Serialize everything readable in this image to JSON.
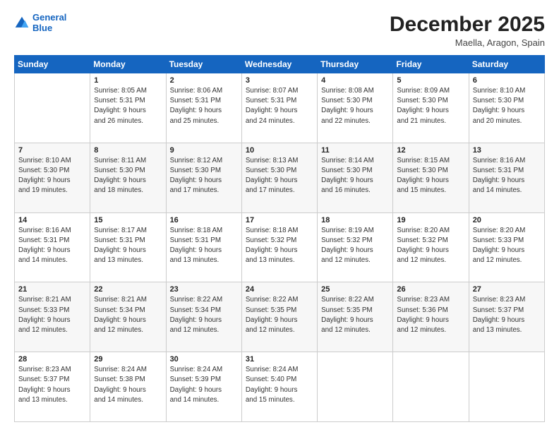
{
  "logo": {
    "line1": "General",
    "line2": "Blue"
  },
  "title": "December 2025",
  "location": "Maella, Aragon, Spain",
  "weekdays": [
    "Sunday",
    "Monday",
    "Tuesday",
    "Wednesday",
    "Thursday",
    "Friday",
    "Saturday"
  ],
  "weeks": [
    [
      {
        "day": "",
        "info": ""
      },
      {
        "day": "1",
        "info": "Sunrise: 8:05 AM\nSunset: 5:31 PM\nDaylight: 9 hours\nand 26 minutes."
      },
      {
        "day": "2",
        "info": "Sunrise: 8:06 AM\nSunset: 5:31 PM\nDaylight: 9 hours\nand 25 minutes."
      },
      {
        "day": "3",
        "info": "Sunrise: 8:07 AM\nSunset: 5:31 PM\nDaylight: 9 hours\nand 24 minutes."
      },
      {
        "day": "4",
        "info": "Sunrise: 8:08 AM\nSunset: 5:30 PM\nDaylight: 9 hours\nand 22 minutes."
      },
      {
        "day": "5",
        "info": "Sunrise: 8:09 AM\nSunset: 5:30 PM\nDaylight: 9 hours\nand 21 minutes."
      },
      {
        "day": "6",
        "info": "Sunrise: 8:10 AM\nSunset: 5:30 PM\nDaylight: 9 hours\nand 20 minutes."
      }
    ],
    [
      {
        "day": "7",
        "info": "Sunrise: 8:10 AM\nSunset: 5:30 PM\nDaylight: 9 hours\nand 19 minutes."
      },
      {
        "day": "8",
        "info": "Sunrise: 8:11 AM\nSunset: 5:30 PM\nDaylight: 9 hours\nand 18 minutes."
      },
      {
        "day": "9",
        "info": "Sunrise: 8:12 AM\nSunset: 5:30 PM\nDaylight: 9 hours\nand 17 minutes."
      },
      {
        "day": "10",
        "info": "Sunrise: 8:13 AM\nSunset: 5:30 PM\nDaylight: 9 hours\nand 17 minutes."
      },
      {
        "day": "11",
        "info": "Sunrise: 8:14 AM\nSunset: 5:30 PM\nDaylight: 9 hours\nand 16 minutes."
      },
      {
        "day": "12",
        "info": "Sunrise: 8:15 AM\nSunset: 5:30 PM\nDaylight: 9 hours\nand 15 minutes."
      },
      {
        "day": "13",
        "info": "Sunrise: 8:16 AM\nSunset: 5:31 PM\nDaylight: 9 hours\nand 14 minutes."
      }
    ],
    [
      {
        "day": "14",
        "info": "Sunrise: 8:16 AM\nSunset: 5:31 PM\nDaylight: 9 hours\nand 14 minutes."
      },
      {
        "day": "15",
        "info": "Sunrise: 8:17 AM\nSunset: 5:31 PM\nDaylight: 9 hours\nand 13 minutes."
      },
      {
        "day": "16",
        "info": "Sunrise: 8:18 AM\nSunset: 5:31 PM\nDaylight: 9 hours\nand 13 minutes."
      },
      {
        "day": "17",
        "info": "Sunrise: 8:18 AM\nSunset: 5:32 PM\nDaylight: 9 hours\nand 13 minutes."
      },
      {
        "day": "18",
        "info": "Sunrise: 8:19 AM\nSunset: 5:32 PM\nDaylight: 9 hours\nand 12 minutes."
      },
      {
        "day": "19",
        "info": "Sunrise: 8:20 AM\nSunset: 5:32 PM\nDaylight: 9 hours\nand 12 minutes."
      },
      {
        "day": "20",
        "info": "Sunrise: 8:20 AM\nSunset: 5:33 PM\nDaylight: 9 hours\nand 12 minutes."
      }
    ],
    [
      {
        "day": "21",
        "info": "Sunrise: 8:21 AM\nSunset: 5:33 PM\nDaylight: 9 hours\nand 12 minutes."
      },
      {
        "day": "22",
        "info": "Sunrise: 8:21 AM\nSunset: 5:34 PM\nDaylight: 9 hours\nand 12 minutes."
      },
      {
        "day": "23",
        "info": "Sunrise: 8:22 AM\nSunset: 5:34 PM\nDaylight: 9 hours\nand 12 minutes."
      },
      {
        "day": "24",
        "info": "Sunrise: 8:22 AM\nSunset: 5:35 PM\nDaylight: 9 hours\nand 12 minutes."
      },
      {
        "day": "25",
        "info": "Sunrise: 8:22 AM\nSunset: 5:35 PM\nDaylight: 9 hours\nand 12 minutes."
      },
      {
        "day": "26",
        "info": "Sunrise: 8:23 AM\nSunset: 5:36 PM\nDaylight: 9 hours\nand 12 minutes."
      },
      {
        "day": "27",
        "info": "Sunrise: 8:23 AM\nSunset: 5:37 PM\nDaylight: 9 hours\nand 13 minutes."
      }
    ],
    [
      {
        "day": "28",
        "info": "Sunrise: 8:23 AM\nSunset: 5:37 PM\nDaylight: 9 hours\nand 13 minutes."
      },
      {
        "day": "29",
        "info": "Sunrise: 8:24 AM\nSunset: 5:38 PM\nDaylight: 9 hours\nand 14 minutes."
      },
      {
        "day": "30",
        "info": "Sunrise: 8:24 AM\nSunset: 5:39 PM\nDaylight: 9 hours\nand 14 minutes."
      },
      {
        "day": "31",
        "info": "Sunrise: 8:24 AM\nSunset: 5:40 PM\nDaylight: 9 hours\nand 15 minutes."
      },
      {
        "day": "",
        "info": ""
      },
      {
        "day": "",
        "info": ""
      },
      {
        "day": "",
        "info": ""
      }
    ]
  ]
}
